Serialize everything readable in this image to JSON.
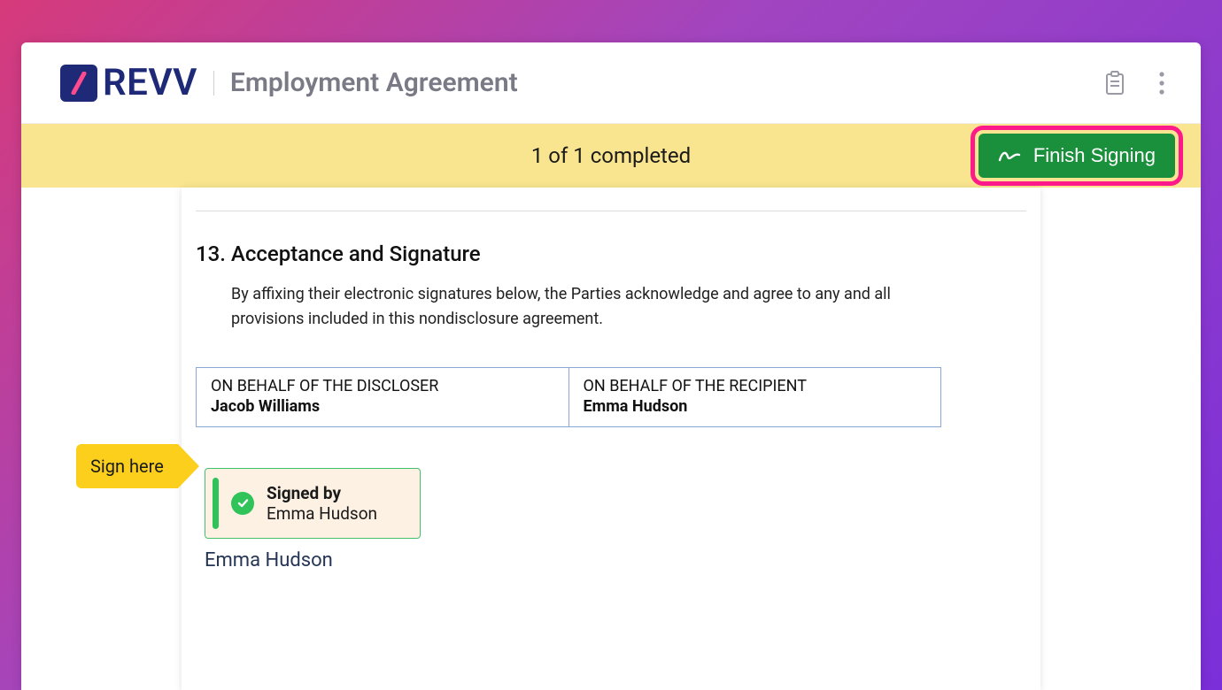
{
  "brand": {
    "name": "REVV"
  },
  "header": {
    "document_title": "Employment Agreement"
  },
  "status_bar": {
    "progress_text": "1 of 1 completed",
    "finish_button_label": "Finish Signing"
  },
  "document": {
    "section_number_title": "13. Acceptance and Signature",
    "section_body": "By affixing their electronic signatures below, the Parties acknowledge and agree to any and all provisions included in this nondisclosure agreement.",
    "parties": [
      {
        "label": "ON BEHALF OF THE DISCLOSER",
        "name": "Jacob Williams"
      },
      {
        "label": "ON BEHALF OF THE RECIPIENT",
        "name": "Emma Hudson"
      }
    ],
    "signed_card": {
      "title": "Signed by",
      "signer": "Emma Hudson"
    },
    "signer_below": "Emma Hudson"
  },
  "flags": {
    "sign_here": "Sign here"
  },
  "colors": {
    "brand_navy": "#1e2a78",
    "accent_pink": "#ff1a8c",
    "status_yellow": "#f9e58f",
    "flag_yellow": "#fccf1c",
    "finish_green": "#1a8f3c",
    "signed_green": "#2fc35a",
    "card_bg": "#fdf1e4"
  }
}
